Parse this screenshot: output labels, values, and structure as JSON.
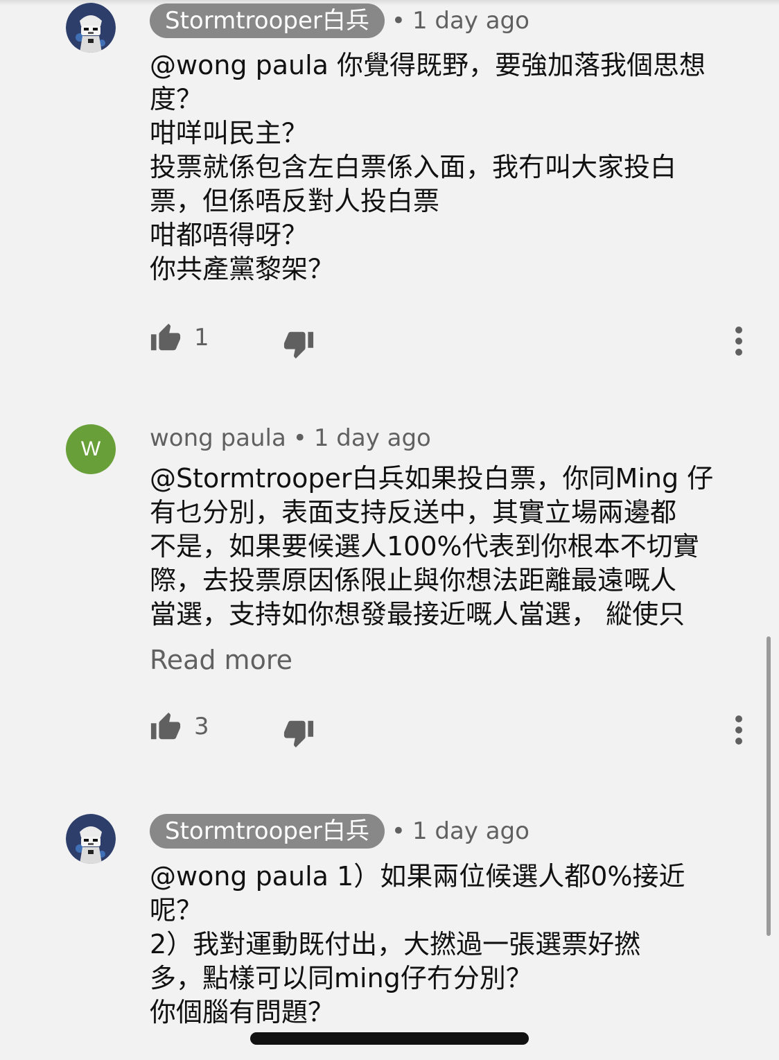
{
  "comments": [
    {
      "author": "Stormtrooper白兵",
      "author_style": "chip",
      "time": "1 day ago",
      "avatar_icon": "stormtrooper-avatar",
      "lines": [
        "@wong paula 你覺得既野，要強加落我個思想",
        "度？",
        "咁咩叫民主？",
        "投票就係包含左白票係入面，我冇叫大家投白",
        "票，但係唔反對人投白票",
        "咁都唔得呀？",
        "你共產黨黎架？"
      ],
      "likes": "1",
      "read_more": null
    },
    {
      "author": "wong paula",
      "author_style": "plain",
      "time": "1 day ago",
      "avatar_letter": "W",
      "avatar_color": "#689f38",
      "lines": [
        "@Stormtrooper白兵如果投白票，你同Ming 仔",
        "有乜分別，表面支持反送中，其實立場兩邊都",
        "不是，如果要候選人100%代表到你根本不切實",
        "際，去投票原因係限止與你想法距離最遠嘅人",
        "當選，支持如你想發最接近嘅人當選， 縱使只"
      ],
      "likes": "3",
      "read_more": "Read more"
    },
    {
      "author": "Stormtrooper白兵",
      "author_style": "chip",
      "time": "1 day ago",
      "avatar_icon": "stormtrooper-avatar",
      "lines": [
        "@wong paula 1）如果兩位候選人都0%接近",
        "呢？",
        "2）我對運動既付出，大撚過一張選票好撚",
        "多，點樣可以同ming仔冇分別？",
        "你個腦有問題？"
      ],
      "likes": null,
      "read_more": null
    }
  ],
  "separator": "•",
  "icons": {
    "like": "thumbs-up-icon",
    "dislike": "thumbs-down-icon",
    "more": "more-vertical-icon"
  },
  "colors": {
    "background": "#f2f2f2",
    "chip": "#888888",
    "secondary_text": "#606060",
    "avatar_w": "#689f38"
  }
}
